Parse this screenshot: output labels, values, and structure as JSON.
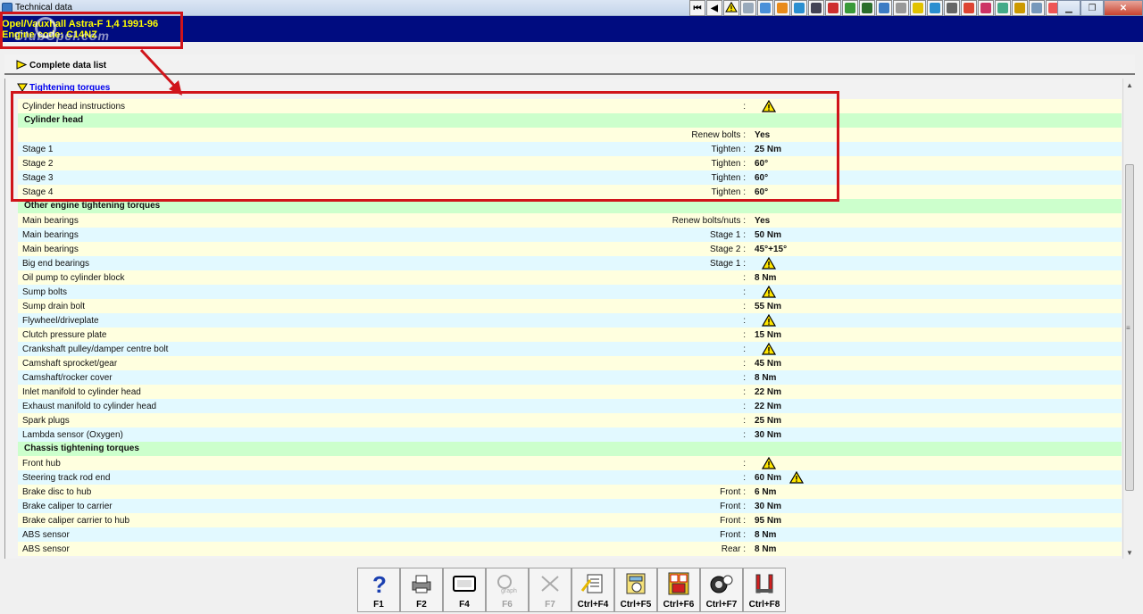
{
  "window": {
    "title": "Technical data"
  },
  "vehicle": {
    "line1": "Opel/Vauxhall  Astra-F  1,4  1991-96",
    "line2": "Engine code: C14NZ",
    "watermark": "ClubOpel.com"
  },
  "nav": {
    "complete_data_list": "Complete data list"
  },
  "section": {
    "title": "Tightening torques"
  },
  "rows": [
    {
      "type": "row",
      "name": "Cylinder head instructions",
      "sub": ":",
      "value": "",
      "warn": true
    },
    {
      "type": "section",
      "name": "Cylinder head"
    },
    {
      "type": "row",
      "name": "",
      "sub": "Renew bolts :",
      "value": "Yes",
      "warn": false
    },
    {
      "type": "row",
      "name": "Stage 1",
      "sub": "Tighten :",
      "value": "25 Nm",
      "warn": false
    },
    {
      "type": "row",
      "name": "Stage 2",
      "sub": "Tighten :",
      "value": "60°",
      "warn": false
    },
    {
      "type": "row",
      "name": "Stage 3",
      "sub": "Tighten :",
      "value": "60°",
      "warn": false
    },
    {
      "type": "row",
      "name": "Stage 4",
      "sub": "Tighten :",
      "value": "60°",
      "warn": false
    },
    {
      "type": "section",
      "name": "Other engine tightening torques"
    },
    {
      "type": "row",
      "name": "Main bearings",
      "sub": "Renew bolts/nuts :",
      "value": "Yes",
      "warn": false
    },
    {
      "type": "row",
      "name": "Main bearings",
      "sub": "Stage 1 :",
      "value": "50 Nm",
      "warn": false
    },
    {
      "type": "row",
      "name": "Main bearings",
      "sub": "Stage 2 :",
      "value": "45°+15°",
      "warn": false
    },
    {
      "type": "row",
      "name": "Big end bearings",
      "sub": "Stage 1 :",
      "value": "",
      "warn": true
    },
    {
      "type": "row",
      "name": "Oil pump to cylinder block",
      "sub": ":",
      "value": "8 Nm",
      "warn": false
    },
    {
      "type": "row",
      "name": "Sump bolts",
      "sub": ":",
      "value": "",
      "warn": true
    },
    {
      "type": "row",
      "name": "Sump drain bolt",
      "sub": ":",
      "value": "55 Nm",
      "warn": false
    },
    {
      "type": "row",
      "name": "Flywheel/driveplate",
      "sub": ":",
      "value": "",
      "warn": true
    },
    {
      "type": "row",
      "name": "Clutch pressure plate",
      "sub": ":",
      "value": "15 Nm",
      "warn": false
    },
    {
      "type": "row",
      "name": "Crankshaft pulley/damper centre bolt",
      "sub": ":",
      "value": "",
      "warn": true
    },
    {
      "type": "row",
      "name": "Camshaft sprocket/gear",
      "sub": ":",
      "value": "45 Nm",
      "warn": false
    },
    {
      "type": "row",
      "name": "Camshaft/rocker cover",
      "sub": ":",
      "value": "8 Nm",
      "warn": false
    },
    {
      "type": "row",
      "name": "Inlet manifold to cylinder head",
      "sub": ":",
      "value": "22 Nm",
      "warn": false
    },
    {
      "type": "row",
      "name": "Exhaust manifold to cylinder head",
      "sub": ":",
      "value": "22 Nm",
      "warn": false
    },
    {
      "type": "row",
      "name": "Spark plugs",
      "sub": ":",
      "value": "25 Nm",
      "warn": false
    },
    {
      "type": "row",
      "name": "Lambda sensor (Oxygen)",
      "sub": ":",
      "value": "30 Nm",
      "warn": false
    },
    {
      "type": "section",
      "name": "Chassis tightening torques"
    },
    {
      "type": "row",
      "name": "Front hub",
      "sub": ":",
      "value": "",
      "warn": true
    },
    {
      "type": "row",
      "name": "Steering track rod end",
      "sub": ":",
      "value": "60 Nm",
      "warn": true
    },
    {
      "type": "row",
      "name": "Brake disc to hub",
      "sub": "Front :",
      "value": "6 Nm",
      "warn": false
    },
    {
      "type": "row",
      "name": "Brake caliper to carrier",
      "sub": "Front :",
      "value": "30 Nm",
      "warn": false
    },
    {
      "type": "row",
      "name": "Brake caliper carrier to hub",
      "sub": "Front :",
      "value": "95 Nm",
      "warn": false
    },
    {
      "type": "row",
      "name": "ABS sensor",
      "sub": "Front :",
      "value": "8 Nm",
      "warn": false
    },
    {
      "type": "row",
      "name": "ABS sensor",
      "sub": "Rear :",
      "value": "8 Nm",
      "warn": false
    }
  ],
  "fkeys": [
    {
      "label": "F1",
      "icon": "help-icon",
      "enabled": true
    },
    {
      "label": "F2",
      "icon": "print-icon",
      "enabled": true
    },
    {
      "label": "F4",
      "icon": "screen-icon",
      "enabled": true
    },
    {
      "label": "F6",
      "icon": "dealer-graphics-icon",
      "enabled": false
    },
    {
      "label": "F7",
      "icon": "tools-icon",
      "enabled": false
    },
    {
      "label": "Ctrl+F4",
      "icon": "notes-icon",
      "enabled": true
    },
    {
      "label": "Ctrl+F5",
      "icon": "calculator-icon",
      "enabled": true
    },
    {
      "label": "Ctrl+F6",
      "icon": "fuses-icon",
      "enabled": true
    },
    {
      "label": "Ctrl+F7",
      "icon": "wheel-gauge-icon",
      "enabled": true
    },
    {
      "label": "Ctrl+F8",
      "icon": "lift-icon",
      "enabled": true
    }
  ],
  "toolbar_icons": [
    "first-icon",
    "prev-icon",
    "warning-icon",
    "doc-icon",
    "photo-icon",
    "gear-icon",
    "wheel-icon",
    "tyre-icon",
    "engine-icon",
    "chart-icon",
    "door-icon",
    "car-icon",
    "brush-icon",
    "light-icon",
    "monitor-icon",
    "tools-icon",
    "wrench-icon",
    "car2-icon",
    "person-icon",
    "road-icon",
    "car3-icon",
    "flag-icon"
  ],
  "colors": {
    "title_bg": "#000c80",
    "title_text": "#ffff00",
    "section_bg": "#ccffcc",
    "row_odd": "#ffffdf",
    "row_even": "#e2f9ff",
    "highlight": "#d0141a"
  }
}
